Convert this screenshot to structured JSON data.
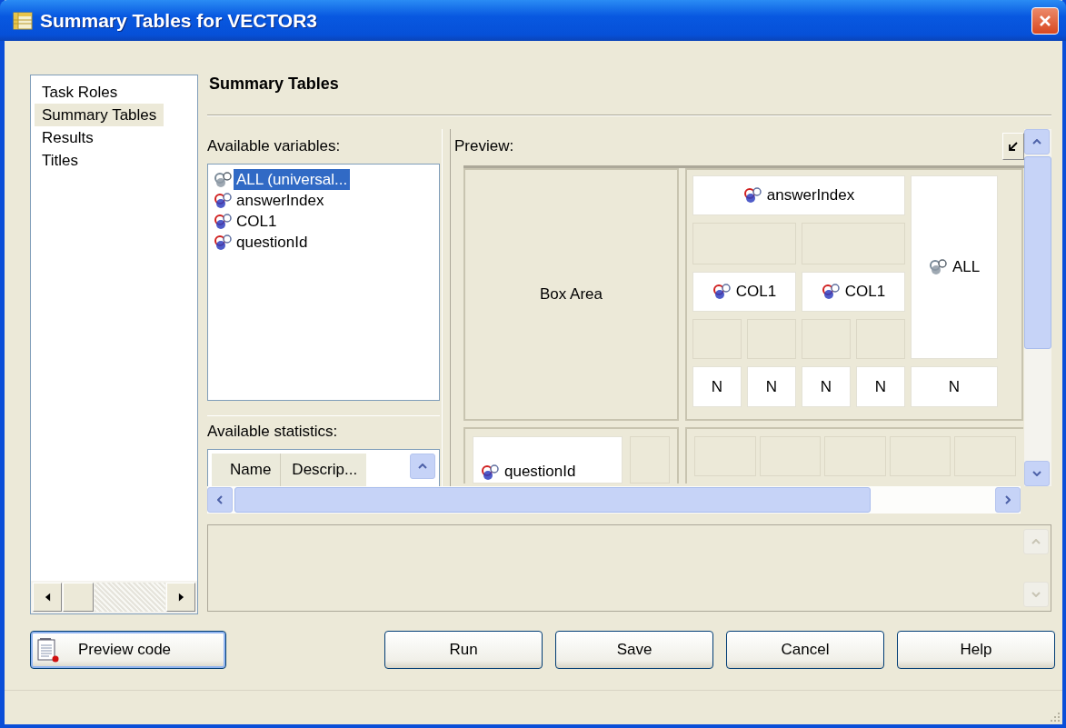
{
  "window": {
    "title": "Summary Tables for VECTOR3"
  },
  "nav": {
    "items": [
      {
        "label": "Task Roles",
        "selected": false
      },
      {
        "label": "Summary Tables",
        "selected": true
      },
      {
        "label": "Results",
        "selected": false
      },
      {
        "label": "Titles",
        "selected": false
      }
    ]
  },
  "page_heading": "Summary Tables",
  "variables": {
    "label": "Available variables:",
    "items": [
      {
        "name": "ALL (universal...",
        "kind": "universal",
        "selected": true
      },
      {
        "name": "answerIndex",
        "kind": "column",
        "selected": false
      },
      {
        "name": "COL1",
        "kind": "column",
        "selected": false
      },
      {
        "name": "questionId",
        "kind": "column",
        "selected": false
      }
    ]
  },
  "statistics": {
    "label": "Available statistics:",
    "columns": [
      "Name",
      "Descrip..."
    ]
  },
  "preview": {
    "label": "Preview:",
    "box_area": "Box Area",
    "column_header": {
      "name": "answerIndex",
      "kind": "column"
    },
    "column_variables": [
      {
        "name": "COL1",
        "kind": "column"
      },
      {
        "name": "COL1",
        "kind": "column"
      }
    ],
    "total": {
      "name": "ALL",
      "kind": "universal"
    },
    "statistics": [
      "N",
      "N",
      "N",
      "N",
      "N"
    ],
    "row_variable": {
      "name": "questionId",
      "kind": "column"
    }
  },
  "buttons": [
    {
      "label": "Preview code",
      "kind": "preview"
    },
    {
      "label": "Run",
      "kind": "action"
    },
    {
      "label": "Save",
      "kind": "action"
    },
    {
      "label": "Cancel",
      "kind": "action"
    },
    {
      "label": "Help",
      "kind": "action"
    }
  ]
}
